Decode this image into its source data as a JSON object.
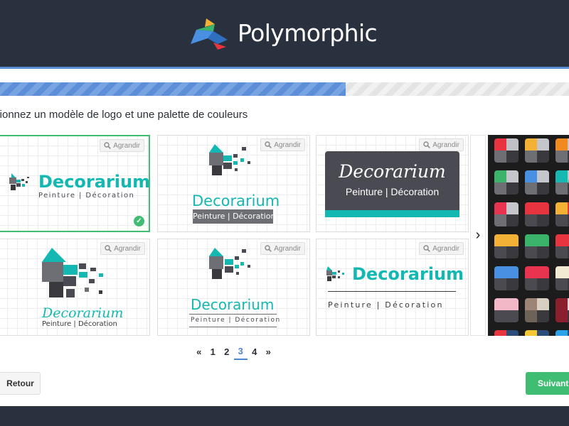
{
  "header": {
    "brand_name": "Polymorphic",
    "logo_icon": "polymorphic-bird-logo"
  },
  "progress": {
    "fraction": 0.607,
    "fill_color": "#5d8fd8"
  },
  "instruction": "ctionnez un modèle de logo et une palette de couleurs",
  "cards": [
    {
      "zoom_label": "Agrandir",
      "brand": "Decorarium",
      "tagline": "Peinture | Décoration",
      "selected": true
    },
    {
      "zoom_label": "Agrandir",
      "brand": "Decorarium",
      "tagline": "Peinture | Décoration",
      "selected": false
    },
    {
      "zoom_label": "Agrandir",
      "brand": "Decorarium",
      "tagline": "Peinture | Décoration",
      "selected": false
    },
    {
      "zoom_label": "Agrandir",
      "brand": "Decorarium",
      "tagline": "Peinture | Décoration",
      "selected": false
    },
    {
      "zoom_label": "Agrandir",
      "brand": "Decorarium",
      "tagline": "Peinture | Décoration",
      "selected": false
    },
    {
      "zoom_label": "Agrandir",
      "brand": "Decorarium",
      "tagline": "Peinture  |  Décoration",
      "selected": false
    }
  ],
  "colors": {
    "teal": "#14b8b2",
    "dark_gray": "#4a4a52",
    "green_accent": "#3fbd72",
    "header_bg": "#2a313e"
  },
  "palettes": [
    {
      "colors": [
        "#e8343f",
        "#bfc1c6",
        "#6e6f74",
        "#3a3a3e"
      ]
    },
    {
      "colors": [
        "#f3b236",
        "#c4c6cb",
        "#6e6f74",
        "#3a3a3e"
      ]
    },
    {
      "colors": [
        "#f08a1e",
        "#c4c6cb",
        "#6e6f74",
        "#3a3a3e"
      ]
    },
    {
      "colors": [
        "#3cb36b",
        "#c4c6cb",
        "#6e6f74",
        "#3a3a3e"
      ]
    },
    {
      "colors": [
        "#4a90e2",
        "#c4c6cb",
        "#6e6f74",
        "#3a3a3e"
      ]
    },
    {
      "colors": [
        "#16b9b1",
        "#c4c6cb",
        "#6e6f74",
        "#3a3a3e"
      ]
    },
    {
      "colors": [
        "#e8344f",
        "#c4c6cb",
        "#6e6f74",
        "#3a3a3e"
      ]
    },
    {
      "colors": [
        "#e8343f",
        "#e8343f",
        "#4a4a50",
        "#3a3a3e"
      ]
    },
    {
      "colors": [
        "#f3b236",
        "#e8343f",
        "#4a4a50",
        "#3a3a3e"
      ]
    },
    {
      "colors": [
        "#f3b236",
        "#f3b236",
        "#4a4a50",
        "#3a3a3e"
      ]
    },
    {
      "colors": [
        "#3cb36b",
        "#3cb36b",
        "#4a4a50",
        "#3a3a3e"
      ]
    },
    {
      "colors": [
        "#e8343f",
        "#e8343f",
        "#4a4a50",
        "#3a3a3e"
      ]
    },
    {
      "colors": [
        "#4a90e2",
        "#4a90e2",
        "#4a4a50",
        "#3a3a3e"
      ]
    },
    {
      "colors": [
        "#e8344f",
        "#e8344f",
        "#4a4a50",
        "#3a3a3e"
      ]
    },
    {
      "colors": [
        "#f3ead3",
        "#f3ead3",
        "#4a4a50",
        "#3a3a3e"
      ]
    },
    {
      "colors": [
        "#f3b8c8",
        "#f3b8c8",
        "#4a4a50",
        "#4a4a50"
      ]
    },
    {
      "colors": [
        "#9c8574",
        "#d8d0c2",
        "#6e6357",
        "#3a3a3e"
      ]
    },
    {
      "colors": [
        "#8b1f2e",
        "#d8d8d8",
        "#8b1f2e",
        "#3a3a3e"
      ]
    },
    {
      "colors": [
        "#e8343f",
        "#2a4d7a",
        "#3a3a3e",
        "#3a3a3e"
      ]
    },
    {
      "colors": [
        "#f3c632",
        "#2a4d7a",
        "#3a3a3e",
        "#3a3a3e"
      ]
    },
    {
      "colors": [
        "#2aa4e8",
        "#2a4d7a",
        "#3a3a3e",
        "#3a3a3e"
      ]
    }
  ],
  "palette_selected_index": 5,
  "pagination": {
    "prev": "«",
    "pages": [
      "1",
      "2",
      "3",
      "4"
    ],
    "current": "3",
    "next": "»"
  },
  "navigation": {
    "back_label": "Retour",
    "next_label": "Suivant"
  }
}
